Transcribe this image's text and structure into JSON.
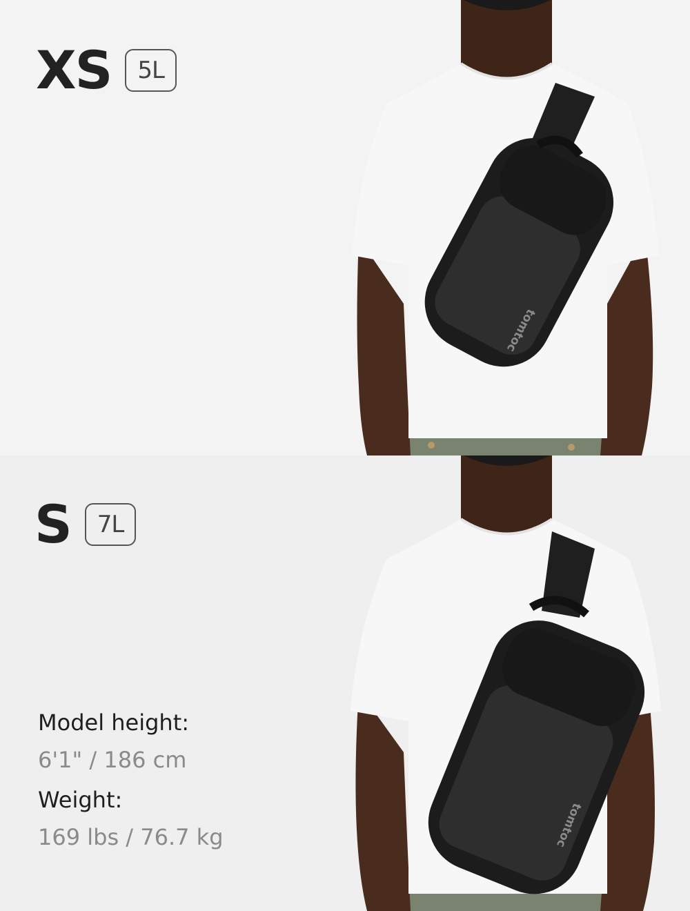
{
  "sizes": [
    {
      "letter": "XS",
      "volume": "5L"
    },
    {
      "letter": "S",
      "volume": "7L"
    }
  ],
  "model": {
    "height_label": "Model height:",
    "height_value": "6'1\" / 186 cm",
    "weight_label": "Weight:",
    "weight_value": "169 lbs / 76.7 kg"
  },
  "brand_text": "tomtoc",
  "colors": {
    "shirt": "#f7f7f7",
    "skin": "#4a2c1e",
    "bag": "#1c1c1c",
    "pants": "#7a8270"
  }
}
